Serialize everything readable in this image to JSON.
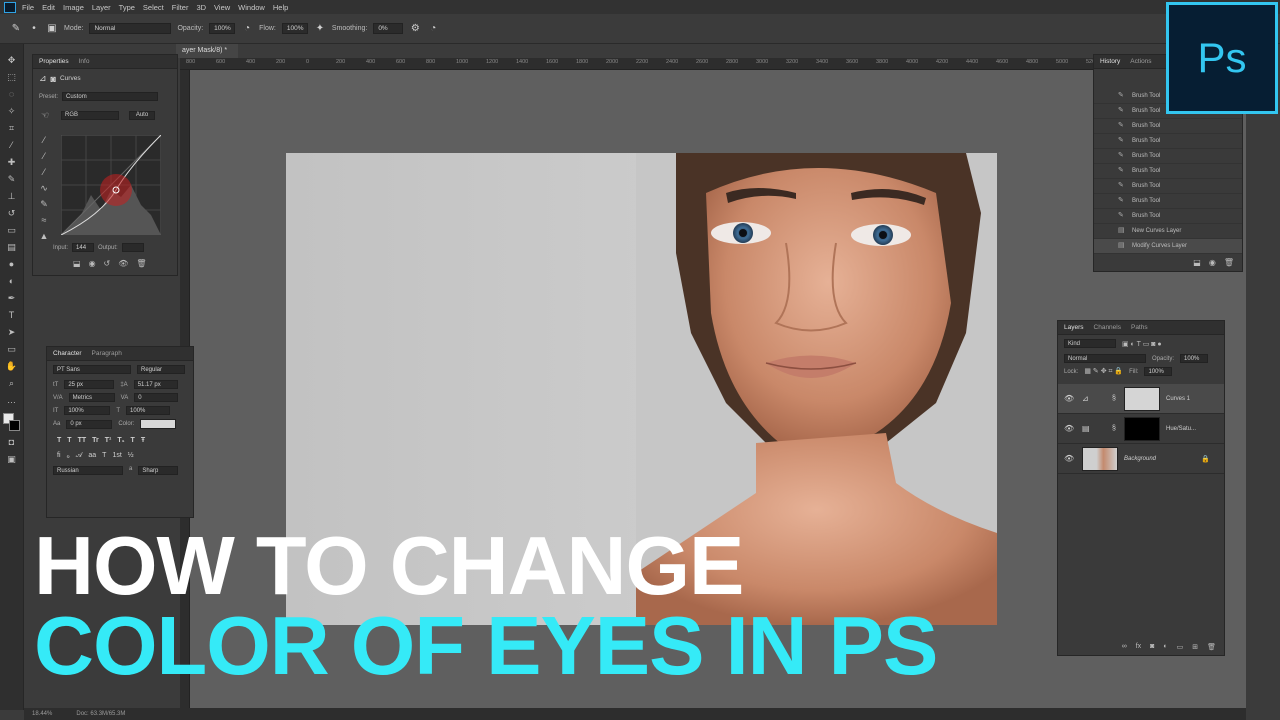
{
  "menu": [
    "File",
    "Edit",
    "Image",
    "Layer",
    "Type",
    "Select",
    "Filter",
    "3D",
    "View",
    "Window",
    "Help"
  ],
  "options": {
    "mode_label": "Mode:",
    "mode_value": "Normal",
    "opacity_label": "Opacity:",
    "opacity_value": "100%",
    "flow_label": "Flow:",
    "flow_value": "100%",
    "smoothing_label": "Smoothing:",
    "smoothing_value": "0%"
  },
  "doc_tab": "ayer Mask/8) *",
  "ruler_ticks": [
    "800",
    "600",
    "400",
    "200",
    "0",
    "200",
    "400",
    "600",
    "800",
    "1000",
    "1200",
    "1400",
    "1600",
    "1800",
    "2000",
    "2200",
    "2400",
    "2600",
    "2800",
    "3000",
    "3200",
    "3400",
    "3600",
    "3800",
    "4000",
    "4200",
    "4400",
    "4600",
    "4800",
    "5000",
    "5200",
    "5400",
    "5600",
    "5800",
    "6000",
    "6200"
  ],
  "properties": {
    "tabs": [
      "Properties",
      "Info"
    ],
    "title": "Curves",
    "preset_label": "Preset:",
    "preset_value": "Custom",
    "channel": "RGB",
    "auto": "Auto",
    "input_label": "Input:",
    "input_value": "144",
    "output_label": "Output:"
  },
  "character": {
    "tabs": [
      "Character",
      "Paragraph"
    ],
    "font_family": "PT Sans",
    "font_style": "Regular",
    "size": "25 px",
    "leading": "51.17 px",
    "kerning": "Metrics",
    "tracking": "0",
    "vscale": "100%",
    "hscale": "100%",
    "baseline": "0 px",
    "color_label": "Color:",
    "language": "Russian",
    "aa": "Sharp"
  },
  "history": {
    "tabs": [
      "History",
      "Actions"
    ],
    "items": [
      "Brush Tool",
      "Brush Tool",
      "Brush Tool",
      "Brush Tool",
      "Brush Tool",
      "Brush Tool",
      "Brush Tool",
      "Brush Tool",
      "Brush Tool",
      "New Curves Layer",
      "Modify Curves Layer"
    ]
  },
  "layers": {
    "tabs": [
      "Layers",
      "Channels",
      "Paths"
    ],
    "kind": "Kind",
    "blend": "Normal",
    "opacity_label": "Opacity:",
    "opacity_value": "100%",
    "lock_label": "Lock:",
    "fill_label": "Fill:",
    "fill_value": "100%",
    "items": [
      "Curves 1",
      "Hue/Satu...",
      "Background"
    ]
  },
  "status": {
    "zoom": "18.44%",
    "doc": "Doc: 63.3M/65.3M"
  },
  "title": {
    "line1": "HOW TO CHANGE",
    "line2": "COLOR OF EYES IN PS"
  },
  "logo": "Ps",
  "colors": {
    "accent": "#35eaf7",
    "logo_bg": "#061e33",
    "logo_border": "#33c6f0"
  }
}
